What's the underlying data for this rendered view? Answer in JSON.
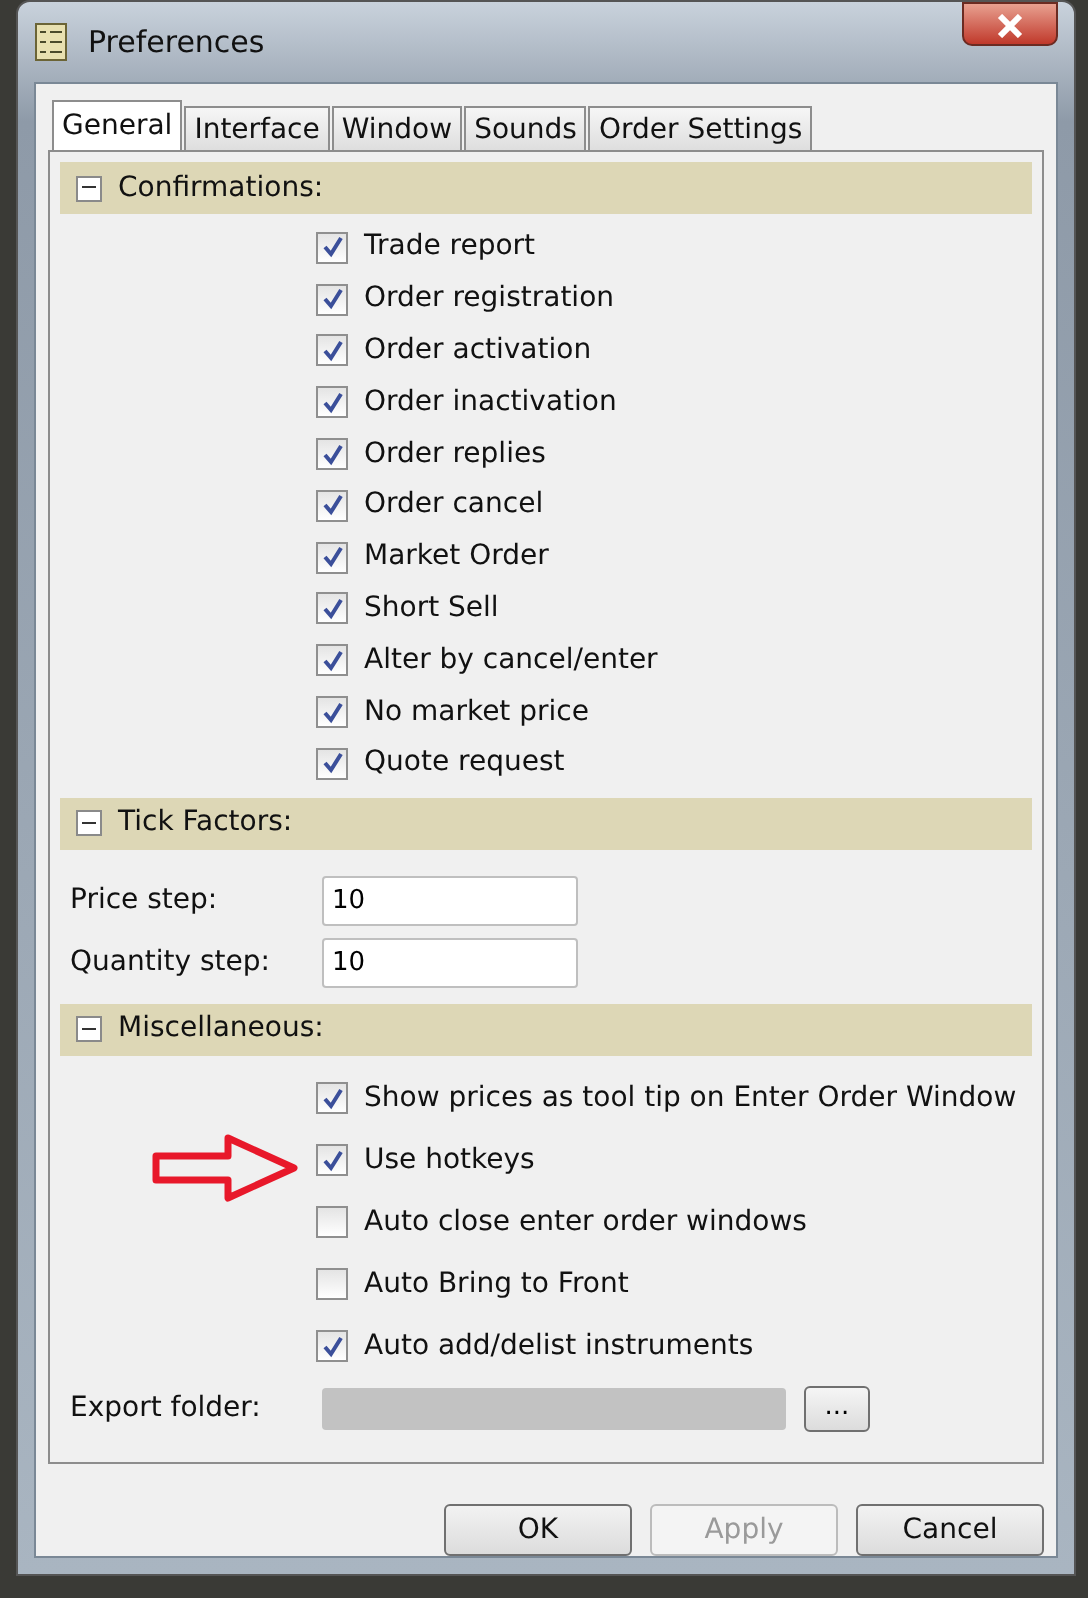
{
  "window": {
    "title": "Preferences"
  },
  "tabs": [
    {
      "label": "General",
      "selected": true
    },
    {
      "label": "Interface",
      "selected": false
    },
    {
      "label": "Window",
      "selected": false
    },
    {
      "label": "Sounds",
      "selected": false
    },
    {
      "label": "Order Settings",
      "selected": false
    }
  ],
  "sections": [
    {
      "title": "Confirmations:",
      "expanded": true,
      "items": [
        {
          "kind": "checkbox",
          "label": "Trade report",
          "checked": true
        },
        {
          "kind": "checkbox",
          "label": "Order registration",
          "checked": true
        },
        {
          "kind": "checkbox",
          "label": "Order activation",
          "checked": true
        },
        {
          "kind": "checkbox",
          "label": "Order inactivation",
          "checked": true
        },
        {
          "kind": "checkbox",
          "label": "Order replies",
          "checked": true
        },
        {
          "kind": "checkbox",
          "label": "Order cancel",
          "checked": true
        },
        {
          "kind": "checkbox",
          "label": "Market Order",
          "checked": true
        },
        {
          "kind": "checkbox",
          "label": "Short Sell",
          "checked": true
        },
        {
          "kind": "checkbox",
          "label": "Alter by cancel/enter",
          "checked": true
        },
        {
          "kind": "checkbox",
          "label": "No market price",
          "checked": true
        },
        {
          "kind": "checkbox",
          "label": "Quote request",
          "checked": true
        }
      ]
    },
    {
      "title": "Tick Factors:",
      "expanded": true,
      "items": [
        {
          "kind": "field",
          "label": "Price step:",
          "value": "10"
        },
        {
          "kind": "field",
          "label": "Quantity step:",
          "value": "10"
        }
      ]
    },
    {
      "title": "Miscellaneous:",
      "expanded": true,
      "items": [
        {
          "kind": "checkbox",
          "label": "Show prices as tool tip on Enter Order Window",
          "checked": true,
          "highlighted": false
        },
        {
          "kind": "checkbox",
          "label": "Use hotkeys",
          "checked": true,
          "highlighted": true
        },
        {
          "kind": "checkbox",
          "label": "Auto close enter order windows",
          "checked": false,
          "highlighted": false
        },
        {
          "kind": "checkbox",
          "label": "Auto Bring to Front",
          "checked": false,
          "highlighted": false
        },
        {
          "kind": "checkbox",
          "label": "Auto add/delist instruments",
          "checked": true,
          "highlighted": false
        },
        {
          "kind": "folder",
          "label": "Export folder:",
          "button": "..."
        }
      ]
    }
  ],
  "buttons": [
    {
      "label": "OK",
      "disabled": false
    },
    {
      "label": "Apply",
      "disabled": true
    },
    {
      "label": "Cancel",
      "disabled": false
    }
  ]
}
